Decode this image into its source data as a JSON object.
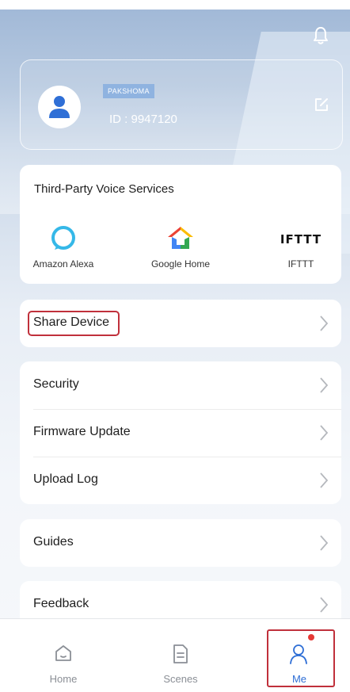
{
  "colors": {
    "accent_blue": "#2f6fd6",
    "highlight_red": "#c0303b",
    "notification_dot": "#e53935",
    "badge_blue": "#8fb3e0"
  },
  "header": {
    "icon": "bell-icon"
  },
  "profile": {
    "name": "PAKSHOMA",
    "id_text": "ID : 9947120",
    "edit_icon": "edit-icon"
  },
  "voice_services": {
    "title": "Third-Party Voice Services",
    "items": [
      {
        "label": "Amazon Alexa",
        "icon": "alexa-icon"
      },
      {
        "label": "Google Home",
        "icon": "google-home-icon"
      },
      {
        "label": "IFTTT",
        "logo_text": "IFTTT",
        "icon": "ifttt-logo"
      }
    ]
  },
  "menu": {
    "share_device": "Share Device",
    "security": "Security",
    "firmware_update": "Firmware Update",
    "upload_log": "Upload Log",
    "guides": "Guides",
    "feedback": "Feedback"
  },
  "tabbar": {
    "tabs": [
      {
        "label": "Home",
        "icon": "home-icon"
      },
      {
        "label": "Scenes",
        "icon": "scenes-icon"
      },
      {
        "label": "Me",
        "icon": "person-icon",
        "active": true
      }
    ]
  }
}
